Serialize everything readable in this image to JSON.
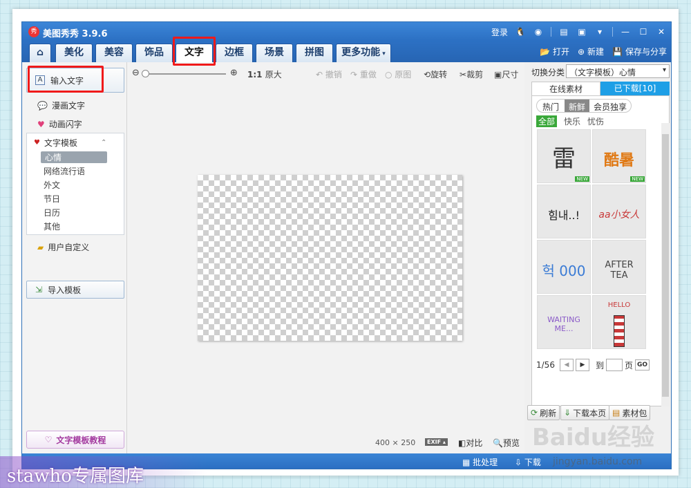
{
  "titlebar": {
    "logo": "秀",
    "title": "美图秀秀 3.9.6",
    "login": "登录"
  },
  "tabs": [
    {
      "label": "美化"
    },
    {
      "label": "美容"
    },
    {
      "label": "饰品"
    },
    {
      "label": "文字",
      "active": true
    },
    {
      "label": "边框"
    },
    {
      "label": "场景"
    },
    {
      "label": "拼图"
    },
    {
      "label": "更多功能"
    }
  ],
  "tab_actions": {
    "open": "打开",
    "new": "新建",
    "save_share": "保存与分享"
  },
  "left_nav": {
    "input_text": "输入文字",
    "comic_text": "漫画文字",
    "flash_text": "动画闪字",
    "template_group": "文字模板",
    "templates": [
      {
        "label": "心情",
        "selected": true
      },
      {
        "label": "网络流行语"
      },
      {
        "label": "外文"
      },
      {
        "label": "节日"
      },
      {
        "label": "日历"
      },
      {
        "label": "其他"
      }
    ],
    "custom": "用户自定义",
    "import": "导入模板",
    "tutorial": "文字模板教程"
  },
  "toolbar": {
    "zoom_label": "1:1",
    "original_size": "原大",
    "undo": "撤销",
    "redo": "重做",
    "original": "原图",
    "rotate": "旋转",
    "crop": "裁剪",
    "size": "尺寸"
  },
  "canvas": {
    "dimensions": "400 × 250",
    "exif": "EXIF",
    "compare": "对比",
    "preview": "预览"
  },
  "right_panel": {
    "category_label": "切换分类",
    "category_value": "（文字模板）心情",
    "tab_online": "在线素材",
    "tab_downloaded": "已下载[10]",
    "sort": [
      "热门",
      "新鲜",
      "会员独享"
    ],
    "sort_selected": "新鲜",
    "filters": [
      "全部",
      "快乐",
      "忧伤"
    ],
    "filter_selected": "全部",
    "thumbnails": [
      {
        "text": "雷",
        "color": "#333",
        "new": true
      },
      {
        "text": "酷暑",
        "color": "#e07a16",
        "new": true
      },
      {
        "text": "힘내..!",
        "color": "#222",
        "new": false
      },
      {
        "text": "aa小女人",
        "color": "#c83838",
        "new": false
      },
      {
        "text": "헉 000",
        "color": "#3a7bd5",
        "new": false
      },
      {
        "text": "AFTER TEA",
        "color": "#444",
        "new": false
      },
      {
        "text": "WAITING ME...",
        "color": "#8a5ac8",
        "new": false
      },
      {
        "text": "HELLO",
        "color": "#c83838",
        "new": false
      }
    ],
    "new_badge": "NEW",
    "page": "1/56",
    "to_page": "到",
    "page_unit": "页",
    "go": "GO",
    "refresh": "刷新",
    "download_page": "下载本页",
    "package": "素材包"
  },
  "status": {
    "batch": "批处理",
    "download": "下载",
    "url": "jingyan.baidu.com"
  },
  "watermark": {
    "text": "stawho专属图库"
  },
  "baidu_mark": {
    "text": "Baidu经验"
  }
}
